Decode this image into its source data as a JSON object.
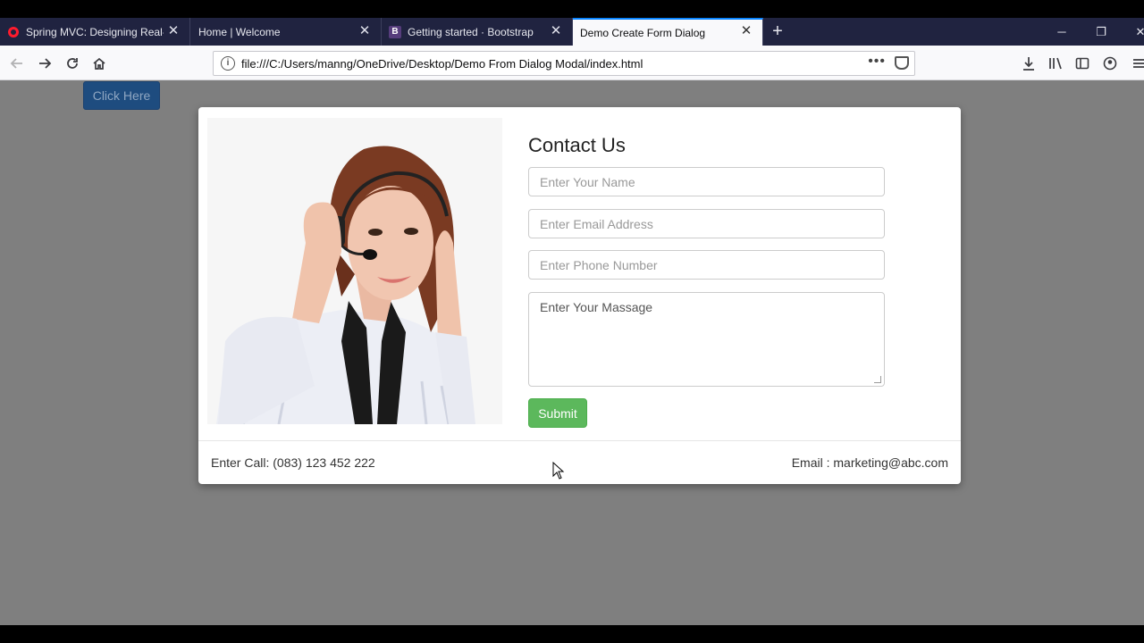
{
  "browser": {
    "tabs": [
      {
        "title": "Spring MVC: Designing Real-W",
        "favicon": "opera-icon",
        "active": false
      },
      {
        "title": "Home | Welcome",
        "favicon": "",
        "active": false
      },
      {
        "title": "Getting started · Bootstrap",
        "favicon": "bootstrap-icon",
        "favicon_text": "B",
        "active": false
      },
      {
        "title": "Demo Create Form Dialog",
        "favicon": "",
        "active": true
      }
    ],
    "new_tab_symbol": "+",
    "url": "file:///C:/Users/manng/OneDrive/Desktop/Demo From Dialog Modal/index.html",
    "accent_color": "#0a84ff"
  },
  "page": {
    "click_button_label": "Click Here",
    "modal": {
      "title": "Contact Us",
      "name_placeholder": "Enter Your Name",
      "email_placeholder": "Enter Email Address",
      "phone_placeholder": "Enter Phone Number",
      "message_placeholder": "Enter Your Massage",
      "submit_label": "Submit",
      "footer_call": "Enter Call: (083) 123 452 222",
      "footer_email": "Email : marketing@abc.com",
      "submit_color": "#5cb85c"
    }
  }
}
